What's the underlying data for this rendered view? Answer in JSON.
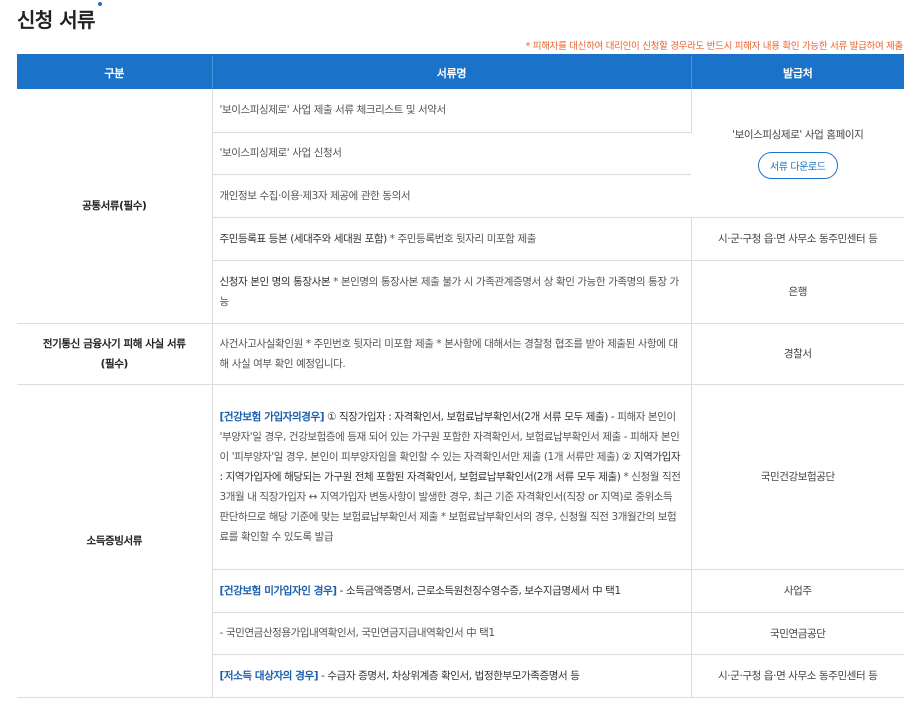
{
  "page": {
    "title": "신청 서류",
    "notice": "* 피해자를 대신하여 대리인이 신청할 경우라도 반드시 피해자 내용 확인 가능한 서류 발급하여 제출"
  },
  "table": {
    "headers": [
      "구분",
      "서류명",
      "발급처"
    ],
    "groups": {
      "common": {
        "category": "공통서류(필수)",
        "items": [
          "'보이스피싱제로' 사업 제출 서류 체크리스트 및 서약서",
          "'보이스피싱제로' 사업 신청서",
          "개인정보 수집·이용·제3자 제공에 관한 동의서"
        ],
        "issuer": "'보이스피싱제로' 사업 홈페이지",
        "download_label": "서류 다운로드",
        "resident": {
          "main": "주민등록표 등본 (세대주와 세대원 포함)",
          "note": " * 주민등록번호 뒷자리 미포함 제출",
          "issuer": "시·군·구청 읍·면 사무소 동주민센터 등"
        },
        "bankbook": {
          "main": "신청자 본인 명의 통장사본",
          "note": " * 본인명의 통장사본 제출 불가 시 가족관계증명서 상 확인 가능한 가족명의 통장 가능",
          "issuer": "은행"
        }
      },
      "fraud": {
        "category_line1": "전기통신 금융사기 피해 사실 서류",
        "category_line2": "(필수)",
        "item": "사건사고사실확인원 * 주민번호 뒷자리 미포함 제출 * 본사항에 대해서는 경찰청 협조를 받아 제출된 사항에 대해 사실 여부 확인 예정입니다.",
        "issuer": "경찰서"
      },
      "income": {
        "category": "소득증빙서류",
        "insured": {
          "title": "[건강보험 가입자의경우]",
          "part1": " ① 직장가입자 : 자격확인서, 보험료납부확인서(2개 서류 모두 제출) -",
          "part2": "피해자 본인이 '부양자'일 경우, 건강보험증에 등재 되어 있는 가구원 포함한 자격확인서, 보험료납부확인서 제출 - 피해자 본인이 '피부양자'일 경우, 본인이 피부양자임을 확인할 수 있는 자격확인서만 제출 (1개 서류만 제출) ",
          "part3": "② 지역가입자 : 지역가입자에 해당되는 가구원 전체 포함된 자격확인서, 보험료납부확인서(2개 서류 모두 제출)",
          "part4": " * 신청월 직전 3개월 내 직장가입자 ↔ 지역가입자 변동사항이 발생한 경우, 최근 기준 자격확인서(직장 or 지역)로 중위소득 판단하므로 해당 기준에 맞는 보험료납부확인서 제출 * 보험료납부확인서의 경우, 신청월 직전 3개월간의 보험료를 확인할 수 있도록 발급",
          "issuer": "국민건강보험공단"
        },
        "uninsured": {
          "title": "[건강보험 미가입자인 경우]",
          "body": " - 소득금액증명서, 근로소득원천징수영수증, 보수지급명세서 中 택1",
          "issuer": "사업주"
        },
        "pension": {
          "body": "- 국민연금산정용가입내역확인서, 국민연금지급내역확인서 中 택1",
          "issuer": "국민연금공단"
        },
        "lowincome": {
          "title": "[저소득 대상자의 경우]",
          "body": " - 수급자 증명서, 차상위계층 확인서, 법정한부모가족증명서 등",
          "issuer": "시·군·구청 읍·면 사무소 동주민센터 등"
        }
      }
    }
  }
}
